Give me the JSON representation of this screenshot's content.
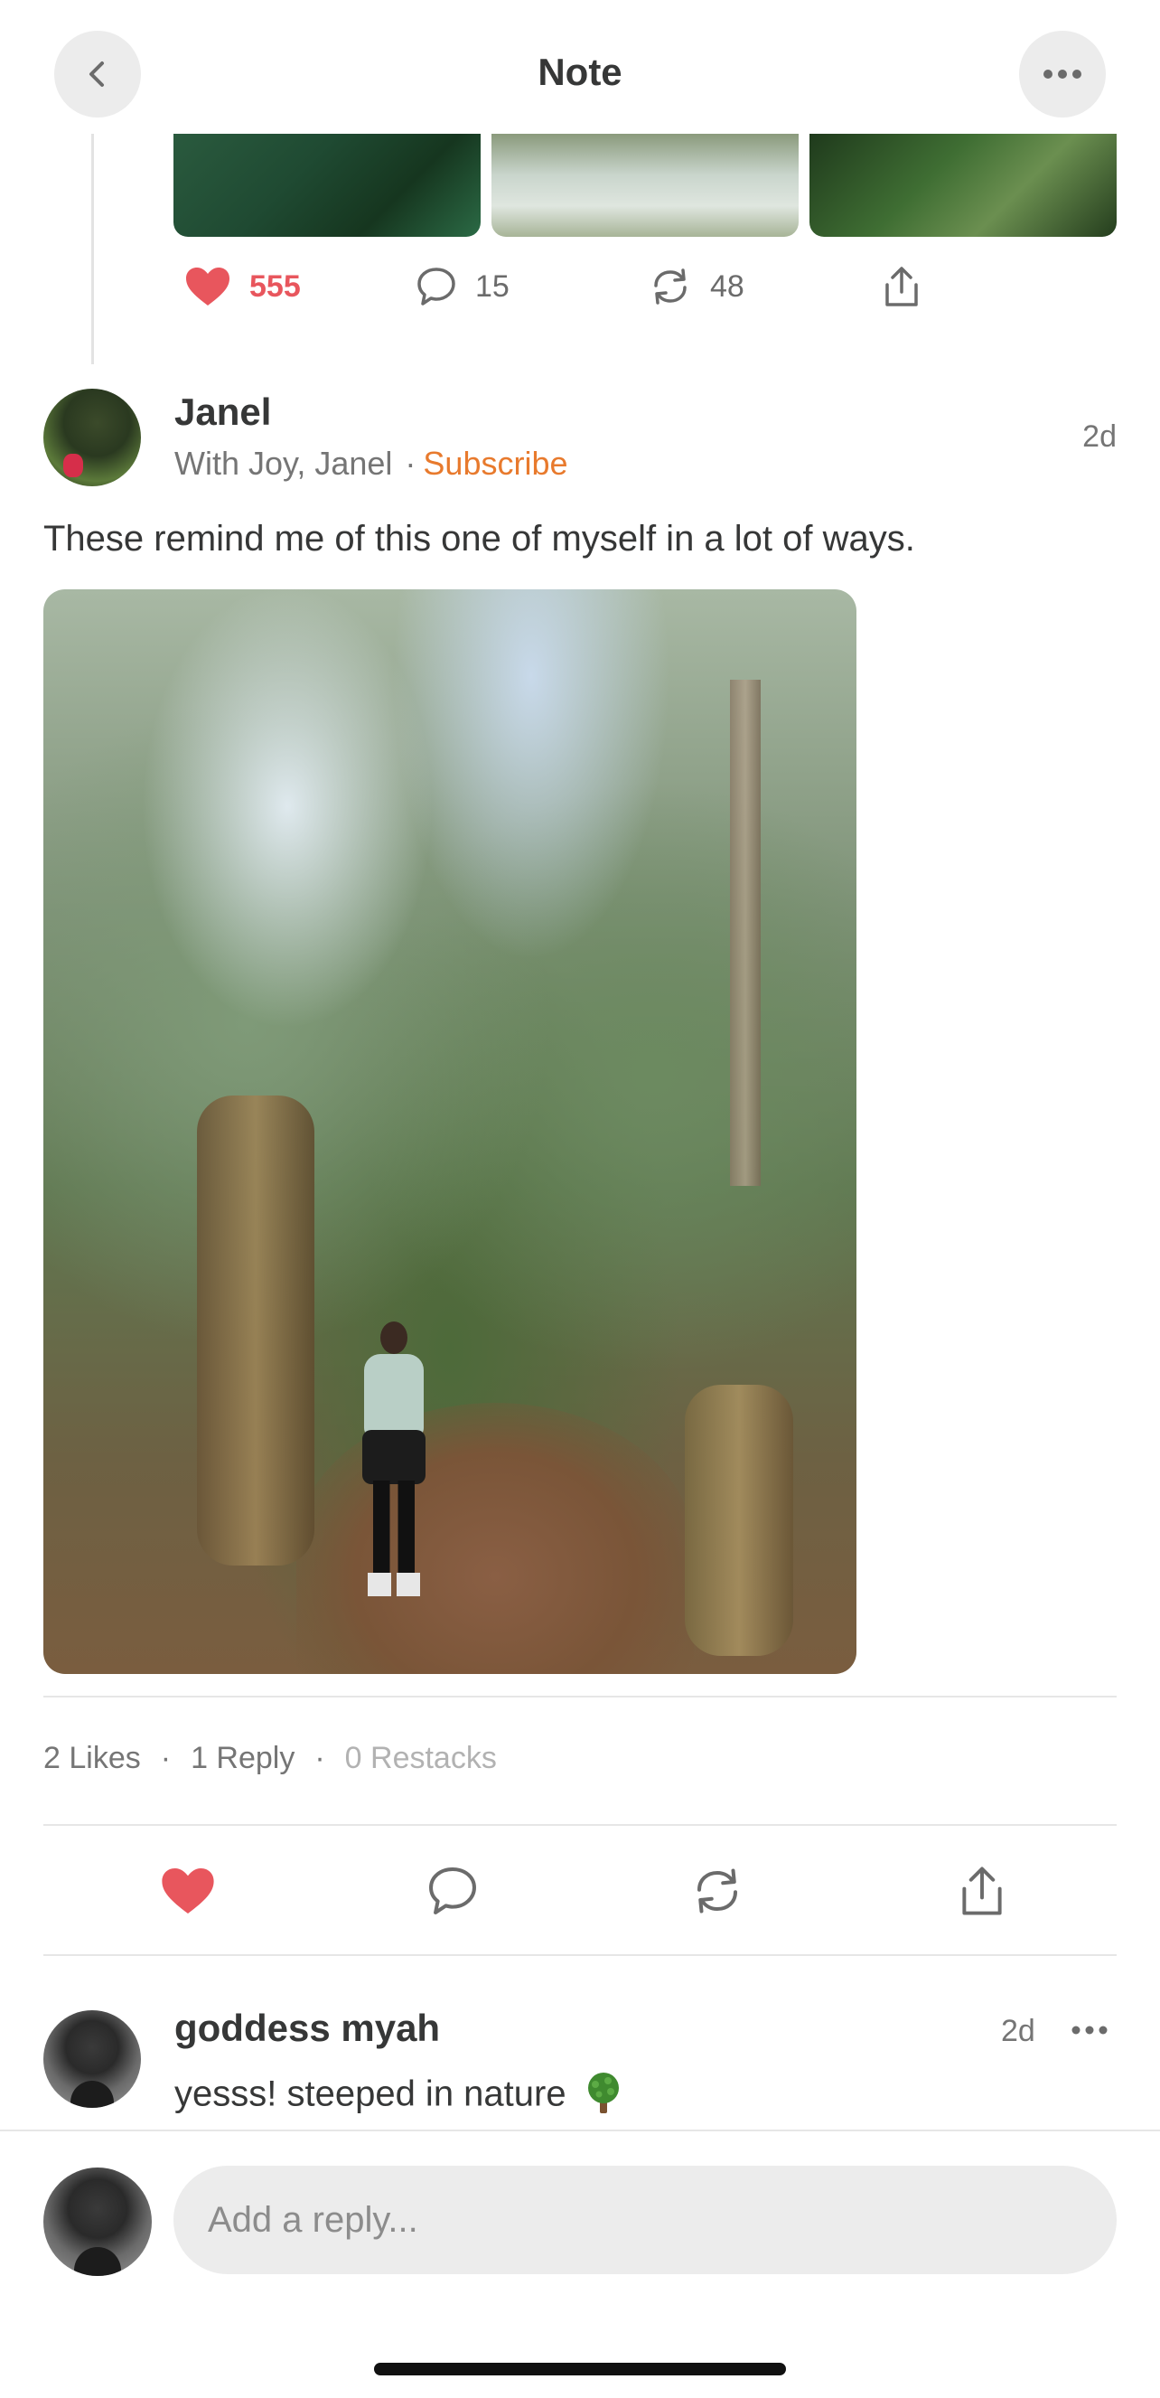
{
  "header": {
    "title": "Note",
    "back_icon": "chevron-left-icon",
    "more_icon": "ellipsis-icon"
  },
  "previous_note": {
    "likes": "555",
    "comments": "15",
    "restacks": "48"
  },
  "post": {
    "author": "Janel",
    "publication": "With Joy, Janel",
    "separator": "·",
    "subscribe_label": "Subscribe",
    "time": "2d",
    "text": "These remind me of this one of myself in a lot of ways.",
    "stats": {
      "likes": "2 Likes",
      "replies": "1 Reply",
      "restacks": "0 Restacks",
      "dot": "·"
    }
  },
  "comment": {
    "author": "goddess myah",
    "time": "2d",
    "text": "yesss! steeped in nature",
    "emoji": "deciduous-tree-icon"
  },
  "reply": {
    "placeholder": "Add a reply..."
  },
  "colors": {
    "accent": "#e87a2d",
    "like_red": "#e8565d",
    "text": "#363737",
    "muted": "#757575"
  }
}
